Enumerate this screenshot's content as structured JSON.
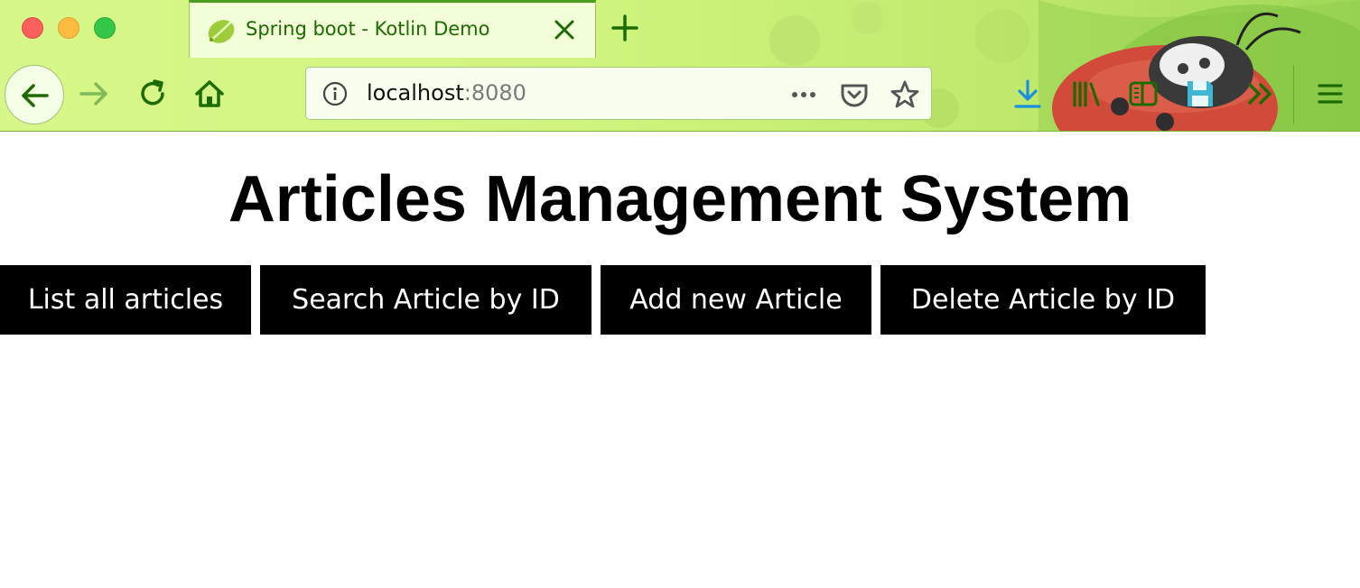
{
  "window": {
    "tab": {
      "title": "Spring boot - Kotlin Demo",
      "favicon": "spring-leaf-icon"
    },
    "address_bar": {
      "host": "localhost",
      "port": ":8080"
    },
    "icons": {
      "back": "arrow-left-icon",
      "forward": "arrow-right-icon",
      "reload": "reload-icon",
      "home": "home-icon",
      "info": "info-icon",
      "page_actions": "more-dots-icon",
      "pocket": "pocket-icon",
      "bookmark": "star-icon",
      "downloads": "download-icon",
      "library": "library-icon",
      "sidebar": "sidebar-icon",
      "save": "floppy-disk-icon",
      "overflow": "double-chevron-icon",
      "menu": "hamburger-menu-icon"
    }
  },
  "page": {
    "title": "Articles Management System",
    "buttons": [
      {
        "label": "List all articles"
      },
      {
        "label": "Search Article by ID"
      },
      {
        "label": "Add new Article"
      },
      {
        "label": "Delete Article by ID"
      }
    ]
  },
  "colors": {
    "chrome_accent": "#1d6b00",
    "button_bg": "#000000",
    "button_text": "#ffffff"
  }
}
